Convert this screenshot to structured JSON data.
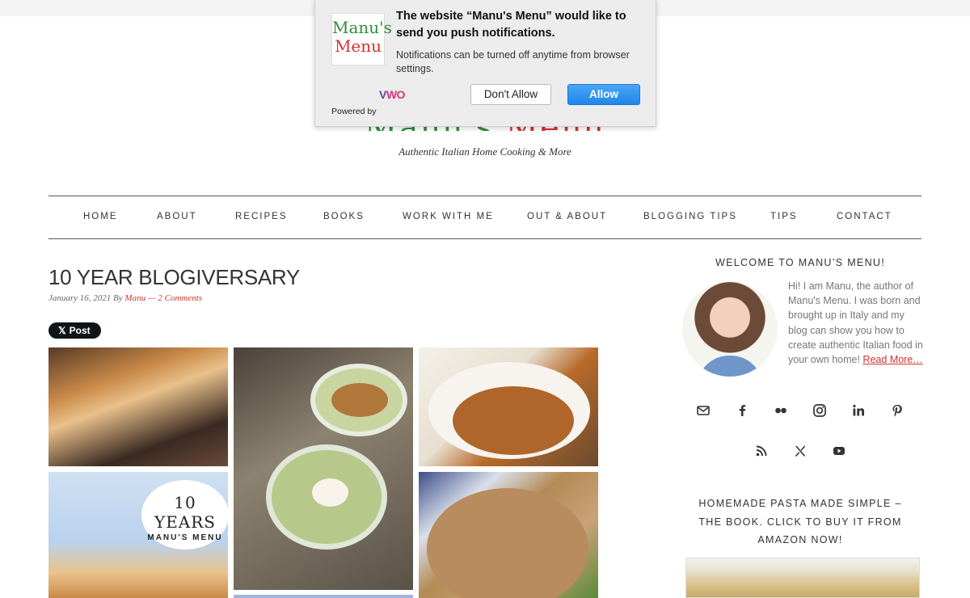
{
  "site": {
    "logo_text_green": "Manu's",
    "logo_text_red": "Menu",
    "tagline": "Authentic Italian Home Cooking & More"
  },
  "nav": {
    "items": [
      {
        "label": "HOME"
      },
      {
        "label": "ABOUT"
      },
      {
        "label": "RECIPES"
      },
      {
        "label": "BOOKS"
      },
      {
        "label": "WORK WITH ME"
      },
      {
        "label": "OUT & ABOUT"
      },
      {
        "label": "BLOGGING TIPS"
      },
      {
        "label": "TIPS"
      },
      {
        "label": "CONTACT"
      }
    ]
  },
  "post": {
    "title": "10 YEAR BLOGIVERSARY",
    "date": "January 16, 2021",
    "by": "By",
    "author": "Manu",
    "separator": "—",
    "comments": "2 Comments",
    "x_post_label": "Post",
    "x_glyph": "𝕏",
    "badge_big": "10 YEARS",
    "badge_small": "MANU'S MENU"
  },
  "sidebar": {
    "welcome_title": "WELCOME TO MANU’S MENU!",
    "intro_text": "Hi! I am Manu, the author of Manu's Menu. I was born and brought up in Italy and my blog can show you how to create authentic Italian food in your own home!",
    "read_more": "Read More…",
    "social_icons": [
      "email-icon",
      "facebook-icon",
      "flickr-icon",
      "instagram-icon",
      "linkedin-icon",
      "pinterest-icon",
      "rss-icon",
      "x-icon",
      "youtube-icon"
    ],
    "book_title": "HOMEMADE PASTA MADE SIMPLE – THE BOOK. CLICK TO BUY IT FROM AMAZON NOW!"
  },
  "notification_prompt": {
    "title": "The website “Manu's Menu” would like to send you push notifications.",
    "body": "Notifications can be turned off anytime from browser settings.",
    "powered_by": "Powered by",
    "vwo_a": "V",
    "vwo_b": "WO",
    "deny_label": "Don't Allow",
    "allow_label": "Allow",
    "logo_green": "Manu's",
    "logo_red": "Menu"
  },
  "colors": {
    "accent_red": "#d4322c",
    "logo_green": "#2f8f3a",
    "allow_blue": "#1f86ea"
  }
}
